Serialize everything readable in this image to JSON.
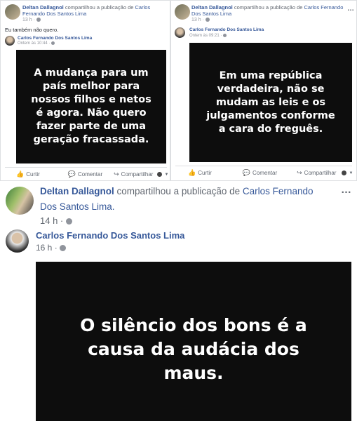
{
  "post1": {
    "author": "Deltan Dallagnol",
    "shared_text": "compartilhou a publicação de",
    "shared_from_line1": "Carlos",
    "shared_from_line2": "Fernando Dos Santos Lima",
    "time": "13 h ·",
    "body": "Eu também não quero.",
    "inner_author": "Carlos Fernando Dos Santos Lima",
    "inner_time": "Ontem às 10:44 ·",
    "quote": "A mudança para um país melhor para nossos filhos e netos é agora. Não quero fazer parte de uma geração fracassada.",
    "like": "Curtir",
    "comment": "Comentar",
    "share": "Compartilhar"
  },
  "post2": {
    "author": "Deltan Dallagnol",
    "shared_text": "compartilhou a publicação de",
    "shared_from_line1": "Carlos Fernando",
    "shared_from_line2": "Dos Santos Lima",
    "time": "13 h ·",
    "inner_author": "Carlos Fernando Dos Santos Lima",
    "inner_time": "Ontem às 09:21 ·",
    "quote": "Em uma república verdadeira, não se mudam as leis e os julgamentos conforme a cara do freguês.",
    "like": "Curtir",
    "comment": "Comentar",
    "share": "Compartilhar"
  },
  "post3": {
    "author": "Deltan Dallagnol",
    "shared_text": "compartilhou a publicação de",
    "shared_from_line1": "Carlos Fernando",
    "shared_from_line2": "Dos Santos Lima.",
    "time": "14 h ·",
    "inner_author": "Carlos Fernando Dos Santos Lima",
    "inner_time": "16 h ·",
    "quote": "O silêncio dos bons é a causa da audácia dos maus."
  },
  "icons": {
    "more": "more-options-icon",
    "globe": "globe-icon",
    "like": "thumbs-up-icon",
    "comment": "comment-icon",
    "share": "share-arrow-icon",
    "audience": "audience-selector-icon"
  }
}
